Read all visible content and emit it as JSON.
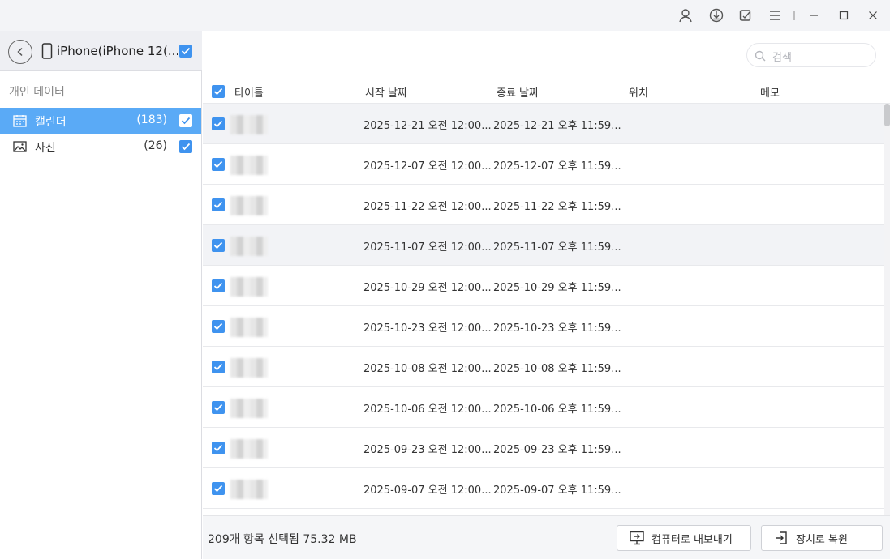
{
  "window": {
    "controls": [
      "user-icon",
      "download-icon",
      "feedback-icon",
      "menu-icon",
      "minimize-icon",
      "maximize-icon",
      "close-icon"
    ]
  },
  "sidebar": {
    "device_name": "iPhone(iPhone 12(...",
    "section_title": "개인 데이터",
    "items": [
      {
        "label": "캘린더",
        "count": "(183)",
        "icon": "calendar-icon",
        "active": true
      },
      {
        "label": "사진",
        "count": "(26)",
        "icon": "photo-icon",
        "active": false
      }
    ]
  },
  "search": {
    "placeholder": "검색"
  },
  "table": {
    "columns": [
      "타이틀",
      "시작 날짜",
      "종료 날짜",
      "위치",
      "메모"
    ],
    "rows": [
      {
        "start": "2025-12-21 오전 12:00...",
        "end": "2025-12-21 오후 11:59..."
      },
      {
        "start": "2025-12-07 오전 12:00...",
        "end": "2025-12-07 오후 11:59..."
      },
      {
        "start": "2025-11-22 오전 12:00...",
        "end": "2025-11-22 오후 11:59..."
      },
      {
        "start": "2025-11-07 오전 12:00...",
        "end": "2025-11-07 오후 11:59..."
      },
      {
        "start": "2025-10-29 오전 12:00...",
        "end": "2025-10-29 오후 11:59..."
      },
      {
        "start": "2025-10-23 오전 12:00...",
        "end": "2025-10-23 오후 11:59..."
      },
      {
        "start": "2025-10-08 오전 12:00...",
        "end": "2025-10-08 오후 11:59..."
      },
      {
        "start": "2025-10-06 오전 12:00...",
        "end": "2025-10-06 오후 11:59..."
      },
      {
        "start": "2025-09-23 오전 12:00...",
        "end": "2025-09-23 오후 11:59..."
      },
      {
        "start": "2025-09-07 오전 12:00...",
        "end": "2025-09-07 오후 11:59..."
      }
    ]
  },
  "footer": {
    "status": "209개 항목 선택됨 75.32 MB",
    "export_label": "컴퓨터로 내보내기",
    "restore_label": "장치로 복원"
  },
  "colors": {
    "accent": "#3f93ef",
    "active_item": "#5aaaf6"
  }
}
